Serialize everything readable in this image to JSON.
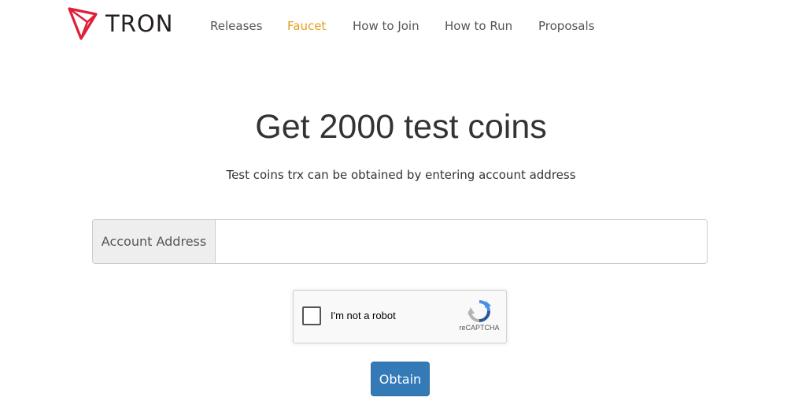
{
  "brand": {
    "name": "TRON",
    "logo_color": "#e0203a"
  },
  "nav": {
    "items": [
      {
        "label": "Releases",
        "active": false
      },
      {
        "label": "Faucet",
        "active": true
      },
      {
        "label": "How to Join",
        "active": false
      },
      {
        "label": "How to Run",
        "active": false
      },
      {
        "label": "Proposals",
        "active": false
      }
    ],
    "active_color": "#e59c1c"
  },
  "hero": {
    "title": "Get 2000 test coins",
    "subtitle": "Test coins trx can be obtained by entering account address"
  },
  "form": {
    "address_label": "Account Address",
    "address_value": "",
    "address_placeholder": ""
  },
  "captcha": {
    "label": "I'm not a robot",
    "brand": "reCAPTCHA",
    "checked": false
  },
  "actions": {
    "obtain_label": "Obtain",
    "button_color": "#337ab7"
  }
}
